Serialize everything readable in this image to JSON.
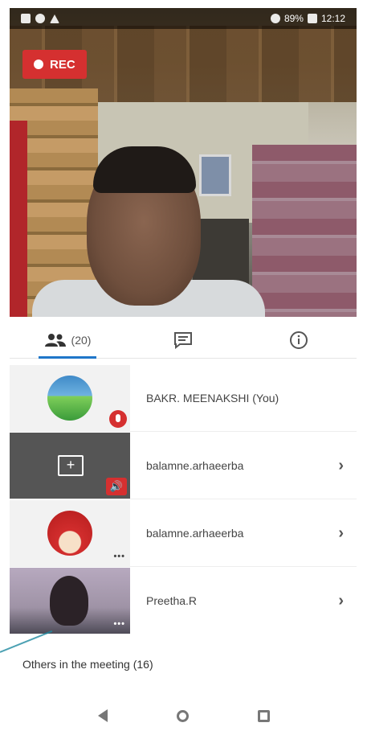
{
  "status_bar": {
    "battery": "89%",
    "time": "12:12"
  },
  "video": {
    "rec_label": "REC"
  },
  "tabs": [
    {
      "name": "participants",
      "label": "(20)",
      "icon": "people-icon",
      "active": true
    },
    {
      "name": "chat",
      "label": "",
      "icon": "chat-icon",
      "active": false
    },
    {
      "name": "info",
      "label": "",
      "icon": "info-icon",
      "active": false
    }
  ],
  "participants": [
    {
      "name": "BAKR. MEENAKSHI (You)",
      "thumb": "landscape-avatar",
      "badge": "muted-mic",
      "chevron": ""
    },
    {
      "name": "balamne.arhaeerba",
      "thumb": "screen-share",
      "badge": "speaker",
      "chevron": "›"
    },
    {
      "name": "balamne.arhaeerba",
      "thumb": "red-avatar",
      "badge": "more",
      "chevron": "›"
    },
    {
      "name": "Preetha.R",
      "thumb": "camera",
      "badge": "more",
      "chevron": "›"
    }
  ],
  "others": "Others in the meeting (16)",
  "colors": {
    "rec": "#d53030",
    "accent": "#1f76c9"
  }
}
